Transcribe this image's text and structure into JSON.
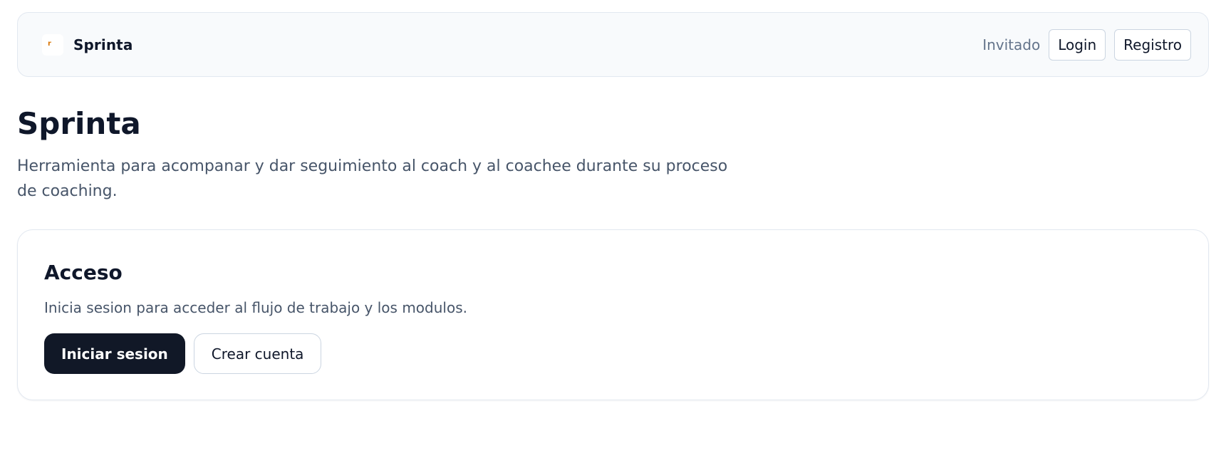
{
  "header": {
    "brand_name": "Sprinta",
    "logo_icon": "sprinta-logo-icon",
    "logo_mark": "r",
    "user_status": "Invitado",
    "login_label": "Login",
    "register_label": "Registro"
  },
  "hero": {
    "title": "Sprinta",
    "description": "Herramienta para acompanar y dar seguimiento al coach y al coachee durante su proceso de coaching."
  },
  "access_card": {
    "title": "Acceso",
    "text": "Inicia sesion para acceder al flujo de trabajo y los modulos.",
    "primary_label": "Iniciar sesion",
    "secondary_label": "Crear cuenta"
  },
  "colors": {
    "page_bg": "#ffffff",
    "topbar_bg": "#f8fafc",
    "primary_button": "#111827",
    "text_dark": "#0f172a",
    "text_muted": "#475569",
    "border": "#e2e8f0"
  }
}
